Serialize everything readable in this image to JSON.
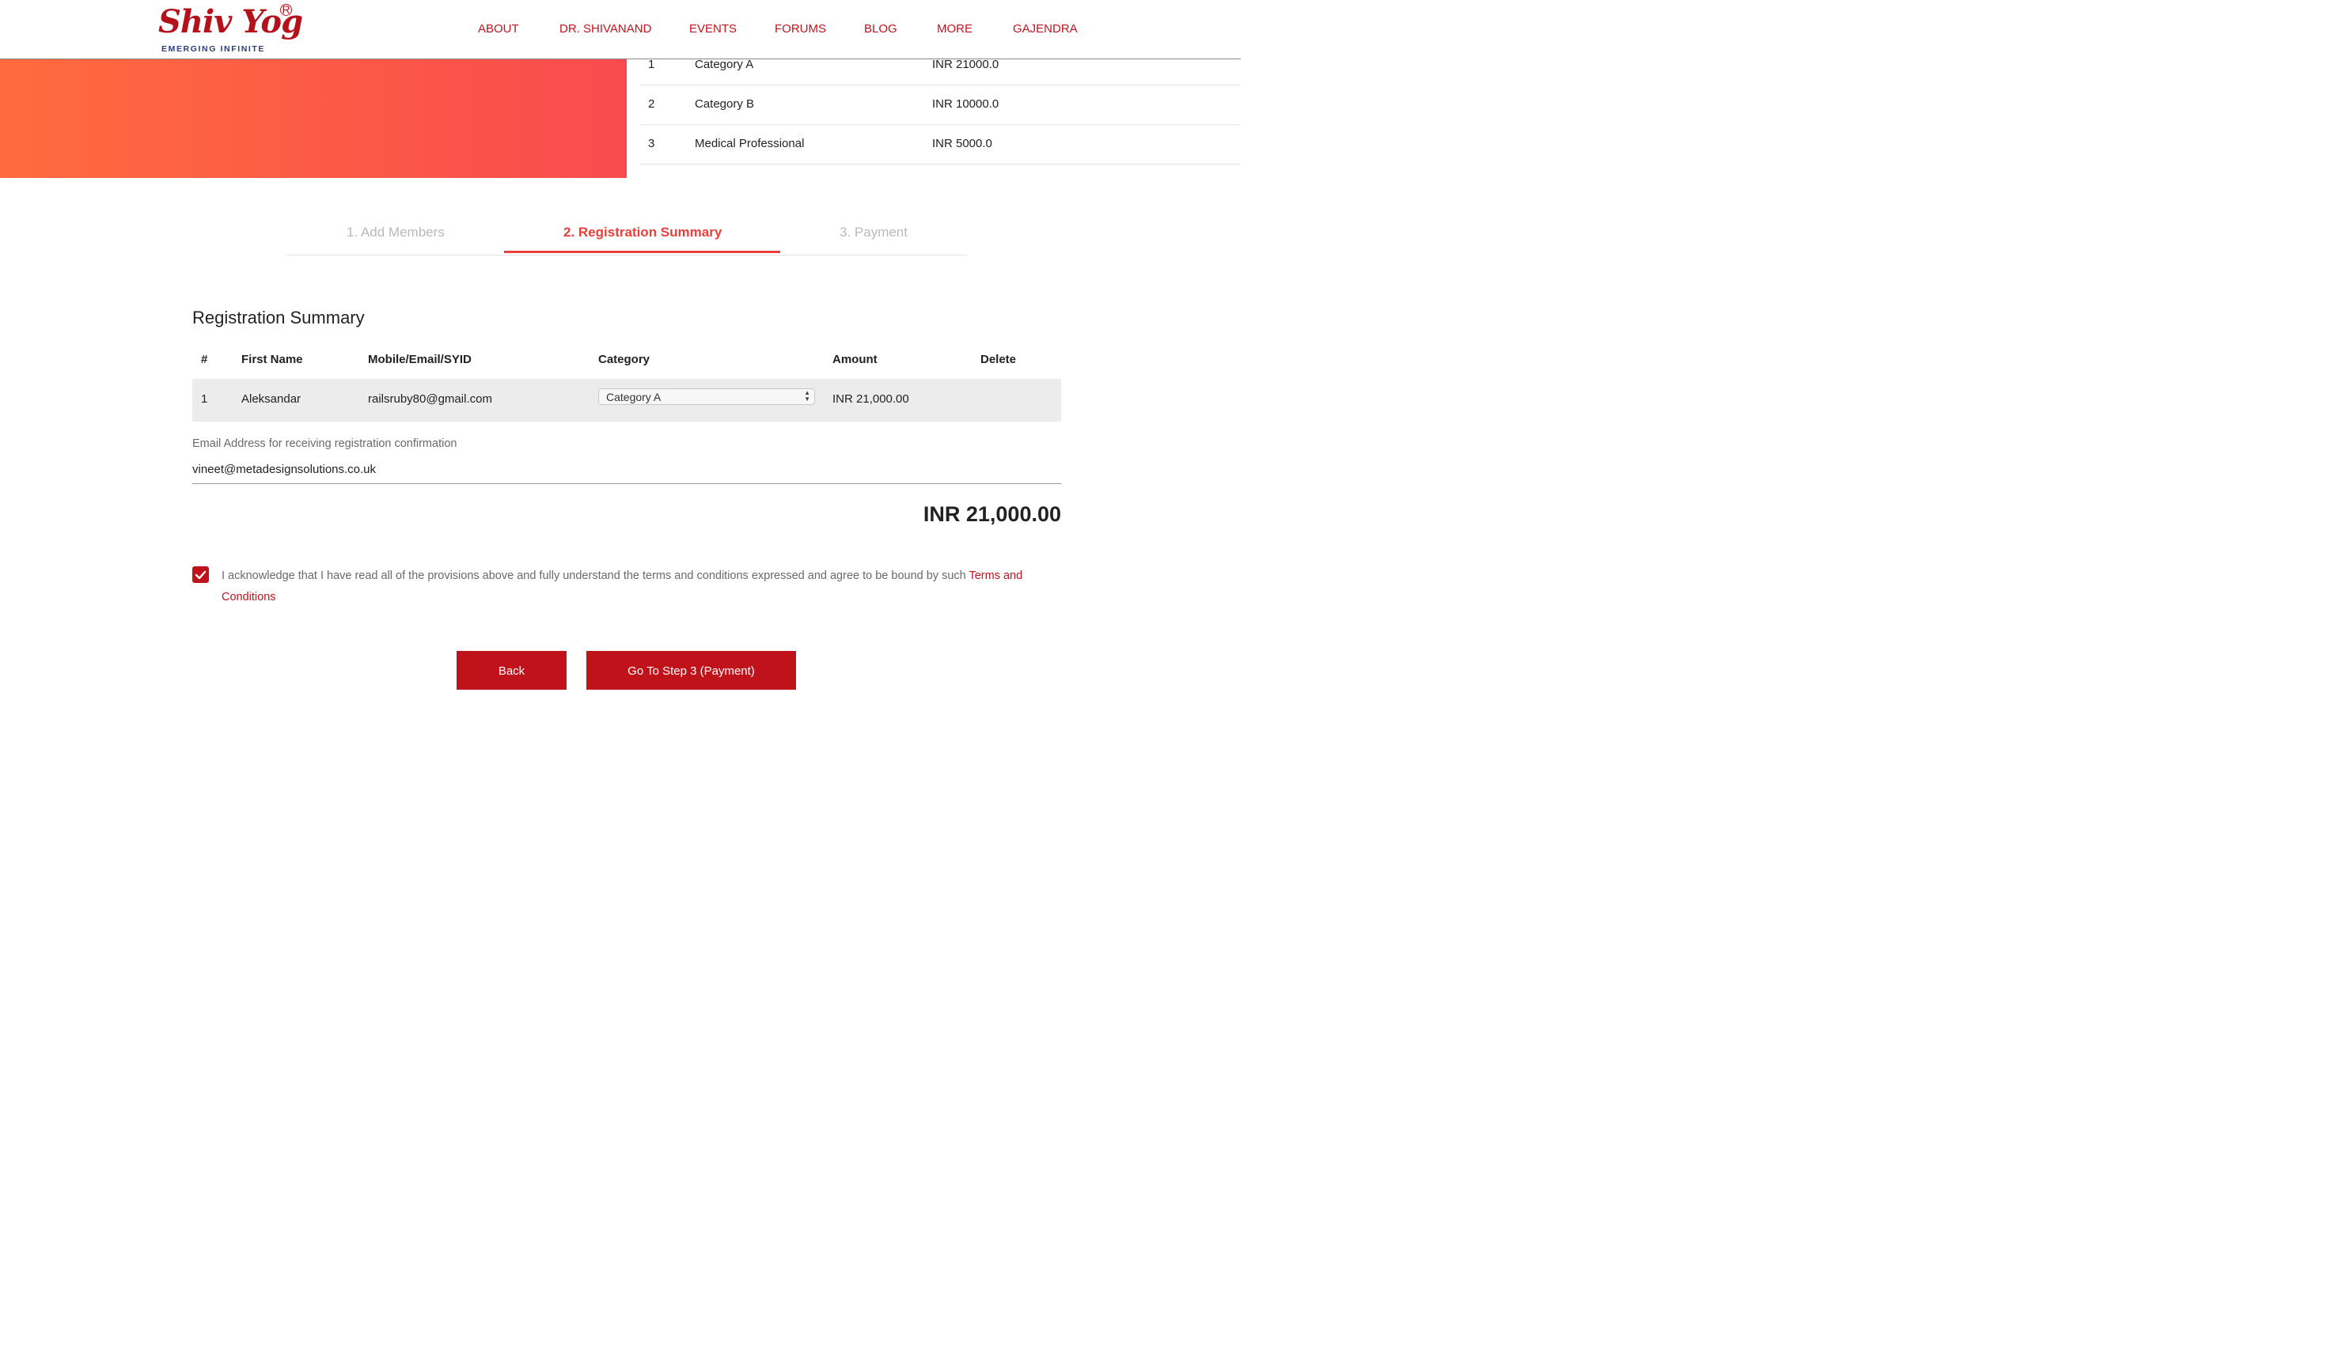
{
  "brand": {
    "name": "Shiv Yog",
    "registered_mark": "R",
    "tagline": "EMERGING INFINITE",
    "color": "#b4121b"
  },
  "nav": {
    "items": [
      "ABOUT",
      "DR. SHIVANAND",
      "EVENTS",
      "FORUMS",
      "BLOG",
      "MORE",
      "GAJENDRA"
    ]
  },
  "pricing": {
    "rows": [
      {
        "num": "1",
        "category": "Category A",
        "price": "INR 21000.0"
      },
      {
        "num": "2",
        "category": "Category B",
        "price": "INR 10000.0"
      },
      {
        "num": "3",
        "category": "Medical Professional",
        "price": "INR 5000.0"
      }
    ]
  },
  "steps": {
    "items": [
      "1. Add Members",
      "2. Registration Summary",
      "3. Payment"
    ],
    "active_index": 1,
    "active_color": "#e8413b"
  },
  "summary": {
    "title": "Registration Summary",
    "headers": {
      "num": "#",
      "first_name": "First Name",
      "contact": "Mobile/Email/SYID",
      "category": "Category",
      "amount": "Amount",
      "delete": "Delete"
    },
    "rows": [
      {
        "num": "1",
        "first_name": "Aleksandar",
        "contact": "railsruby80@gmail.com",
        "category": "Category A",
        "amount": "INR 21,000.00"
      }
    ],
    "email_label": "Email Address for receiving registration confirmation",
    "email_value": "vineet@metadesignsolutions.co.uk",
    "total": "INR 21,000.00"
  },
  "terms": {
    "checked": true,
    "text": "I acknowledge that I have read all of the provisions above and fully understand the terms and conditions expressed and agree to be bound by such",
    "link_text": "Terms and Conditions"
  },
  "buttons": {
    "back": "Back",
    "next": "Go To Step 3 (Payment)",
    "color": "#c0121b"
  },
  "hero": {
    "gradient_start": "#ff6b3d",
    "gradient_end": "#f94b4f"
  }
}
